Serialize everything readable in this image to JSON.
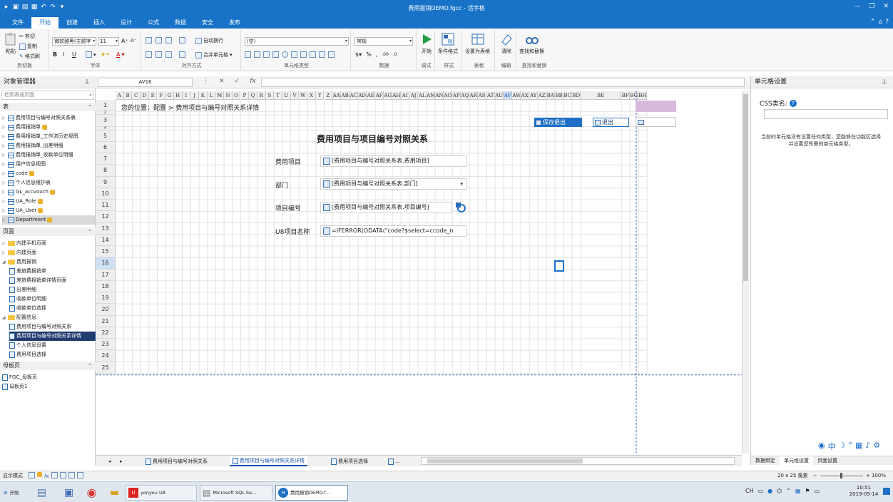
{
  "window": {
    "title": "费用报销DEMO.fgcc - 活字格"
  },
  "tabs": [
    "文件",
    "开始",
    "创建",
    "插入",
    "设计",
    "公式",
    "数据",
    "安全",
    "发布"
  ],
  "ribbon": {
    "paste": "粘贴",
    "cut": "剪切",
    "copy": "复制",
    "format_painter": "格式刷",
    "clipboard_group": "剪切板",
    "font_name": "微软雅黑(主题字",
    "font_size": "11",
    "font_group": "字体",
    "wrap_text": "自动换行",
    "merge_cells": "合并单元格",
    "align_group": "对齐方式",
    "celltype_value": "(空)",
    "celltype_group": "单元格类型",
    "number_format": "常规",
    "number_group": "数据",
    "start_label": "开始",
    "debug_group": "调试",
    "conditional_format": "条件格式",
    "style_group": "样式",
    "set_as_table": "设置为表格",
    "table_group": "表格",
    "clear": "清除",
    "edit_group": "编辑",
    "find_replace": "查找和替换",
    "find_group": "查找和替换"
  },
  "left_pane": {
    "title": "对象管理器",
    "search_placeholder": "检索表或页面",
    "table_section": "表",
    "tables": [
      {
        "name": "费用项目与编号对照关系表",
        "lock": false
      },
      {
        "name": "费用报销单",
        "lock": true
      },
      {
        "name": "费用报销单_工作流历史视图",
        "lock": false
      },
      {
        "name": "费用报销单_出差明细",
        "lock": false
      },
      {
        "name": "费用报销单_收款单位明细",
        "lock": false
      },
      {
        "name": "用户信息视图",
        "lock": false
      },
      {
        "name": "code",
        "lock": true
      },
      {
        "name": "个人信息维护表",
        "lock": false
      },
      {
        "name": "GL_accvouch",
        "lock": true
      },
      {
        "name": "UA_Role",
        "lock": true
      },
      {
        "name": "UA_User",
        "lock": true
      },
      {
        "name": "Department",
        "lock": true
      }
    ],
    "page_section": "页面",
    "pages": [
      {
        "name": "内建手机页面",
        "type": "folder",
        "indent": 0
      },
      {
        "name": "内建页面",
        "type": "folder",
        "indent": 0
      },
      {
        "name": "费用报销",
        "type": "folder",
        "indent": 0
      },
      {
        "name": "差旅费报销单",
        "type": "page",
        "indent": 1
      },
      {
        "name": "差旅费报销单详情页面",
        "type": "page",
        "indent": 1
      },
      {
        "name": "出差明细",
        "type": "page",
        "indent": 1
      },
      {
        "name": "收款单位明细",
        "type": "page",
        "indent": 1
      },
      {
        "name": "收款单位选择",
        "type": "page",
        "indent": 1
      },
      {
        "name": "配置信息",
        "type": "folder",
        "indent": 0
      },
      {
        "name": "费用项目与编号对照关系",
        "type": "page",
        "indent": 1
      },
      {
        "name": "费用项目与编号对照关系详情",
        "type": "page",
        "indent": 1
      },
      {
        "name": "个人信息设置",
        "type": "page",
        "indent": 1
      },
      {
        "name": "费用项目选择",
        "type": "page",
        "indent": 1
      }
    ],
    "master_section": "母板页",
    "masters": [
      "FGC_母板页",
      "母板页1"
    ]
  },
  "formula_bar": {
    "name_box": "AV16",
    "formula": ""
  },
  "grid": {
    "columns": [
      "A",
      "B",
      "C",
      "D",
      "E",
      "F",
      "G",
      "H",
      "I",
      "J",
      "K",
      "L",
      "M",
      "N",
      "O",
      "P",
      "Q",
      "R",
      "S",
      "T",
      "U",
      "V",
      "W",
      "X",
      "Y",
      "Z",
      "AA",
      "AB",
      "AC",
      "AD",
      "AE",
      "AF",
      "AG",
      "AH",
      "AI",
      "AJ",
      "AL",
      "AM",
      "AN",
      "AO",
      "AP",
      "AQ",
      "AR",
      "AS",
      "AT",
      "AU",
      "AV",
      "AW",
      "AX",
      "AY",
      "AZ",
      "BA",
      "BB",
      "BC",
      "BD",
      "BE",
      "BF",
      "BG",
      "BH"
    ],
    "rows": [
      "1",
      "2",
      "3",
      "4",
      "5",
      "6",
      "7",
      "8",
      "9",
      "10",
      "11",
      "12",
      "13",
      "14",
      "15",
      "16",
      "17",
      "18",
      "19",
      "20",
      "21",
      "22",
      "23",
      "24",
      "25"
    ],
    "selected_row": "16",
    "selected_col": "AV",
    "breadcrumb": "您的位置：配置 > 费用项目与编号对照关系详情",
    "page_title": "费用项目与项目编号对照关系",
    "fields": [
      {
        "label": "费用项目",
        "value": "[费用项目与编号对照关系表.费用项目]"
      },
      {
        "label": "部门",
        "value": "[费用项目与编号对照关系表.部门]"
      },
      {
        "label": "项目编号",
        "value": "[费用项目与编号对照关系表.项目编号]"
      },
      {
        "label": "U8项目名称",
        "value": "=IFERROR(ODATA(\"code?$select=ccode_n"
      }
    ],
    "save_exit": "保存退出",
    "exit": "退出"
  },
  "sheet_tabs": [
    "费用项目与编号对照关系",
    "费用项目与编号对照关系详情",
    "费用项目选择"
  ],
  "sheet_more": "...",
  "right_pane": {
    "title": "单元格设置",
    "css_label": "CSS类名:",
    "help": "?",
    "info": "当前的单元格没有设置任何类型，您能够在功能区选择并设置您所需的单元格类型。",
    "bottom_tabs": [
      "数据绑定",
      "单元格设置",
      "页面设置"
    ]
  },
  "status": {
    "mode": "显示模式",
    "size": "20 x 25 像素",
    "zoom": "100%"
  },
  "taskbar": {
    "start": "开始",
    "apps": [
      "yonyou U8",
      "Microsoft SQL Se...",
      "费用报销DEMO.f..."
    ],
    "lang": "CH",
    "time": "10:51",
    "date": "2019-05-14"
  },
  "colors": {
    "titlebar": "#1873c8",
    "selected": "#1f3c6e",
    "accent": "#1a56b0",
    "purple_cell": "#d8b9dd"
  }
}
